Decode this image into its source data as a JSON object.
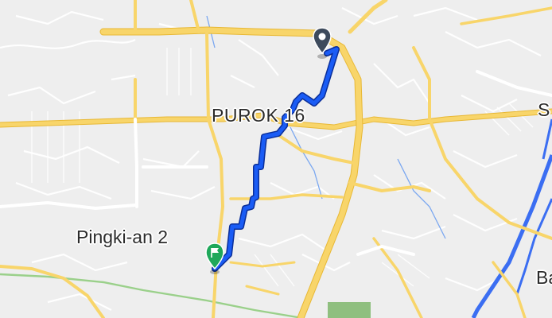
{
  "map": {
    "labels": {
      "purok": "PUROK 16",
      "pingki": "Pingki-an 2",
      "edge_top_right": "S",
      "edge_bottom_right": "Ba"
    },
    "colors": {
      "route": "#1a5cf5",
      "route_outline": "#0b2f9a",
      "major_road": "#f4cf5a",
      "minor_road": "#ffffff",
      "river": "#3b6ef2",
      "park": "#8fbf7f",
      "rail": "#9ad08a"
    },
    "icons": {
      "start": "location-pin-icon",
      "end": "finish-flag-pin-icon"
    }
  }
}
